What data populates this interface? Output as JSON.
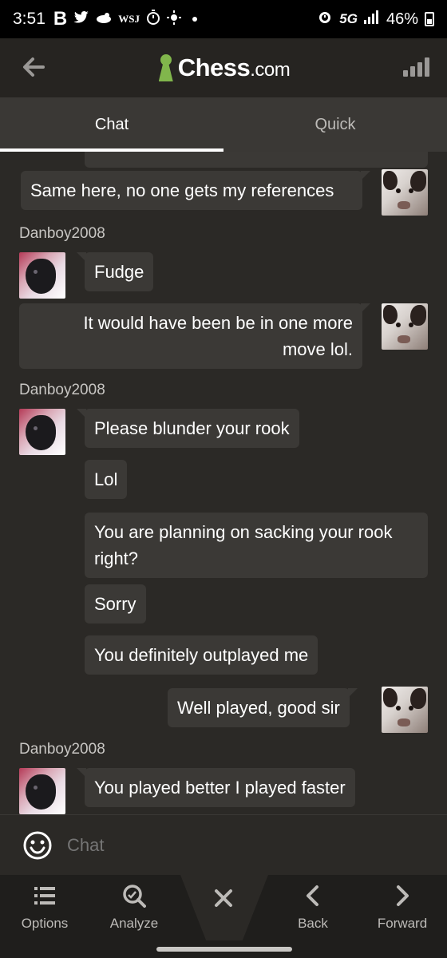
{
  "status": {
    "time": "3:51",
    "notif_b": "B",
    "notif_wsj": "WSJ",
    "network": "5G",
    "battery": "46%"
  },
  "header": {
    "logo_main": "Chess",
    "logo_suffix": ".com"
  },
  "tabs": [
    {
      "label": "Chat"
    },
    {
      "label": "Quick"
    }
  ],
  "chat": {
    "messages": [
      {
        "text": "Same here, no one gets my references"
      },
      {
        "username": "Danboy2008"
      },
      {
        "text": "Fudge"
      },
      {
        "line1": "It would have been be in one more",
        "line2": "move lol."
      },
      {
        "username": "Danboy2008"
      },
      {
        "text": "Please blunder your rook"
      },
      {
        "text": "Lol"
      },
      {
        "line1": "You are planning on sacking your rook",
        "line2": "right?"
      },
      {
        "text": "Sorry"
      },
      {
        "text": "You definitely outplayed me"
      },
      {
        "text": "Well played, good sir"
      },
      {
        "username": "Danboy2008"
      },
      {
        "text": "You played better I played faster"
      }
    ]
  },
  "input": {
    "placeholder": "Chat"
  },
  "toolbar": {
    "items": [
      {
        "label": "Options"
      },
      {
        "label": "Analyze"
      },
      {
        "label": ""
      },
      {
        "label": "Back"
      },
      {
        "label": "Forward"
      }
    ]
  }
}
